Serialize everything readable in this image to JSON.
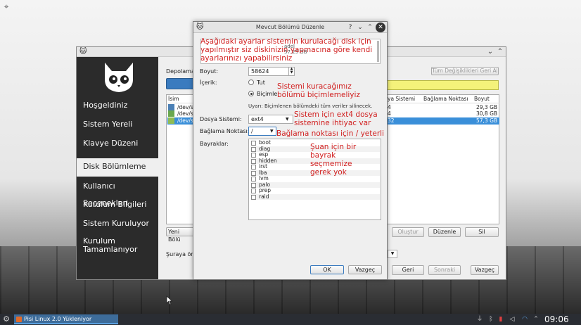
{
  "desktop": {
    "corner_icon": "kde-plasma-icon"
  },
  "installer": {
    "sidebar": [
      {
        "label": "Hoşgeldiniz"
      },
      {
        "label": "Sistem Yereli"
      },
      {
        "label": "Klavye Düzeni"
      },
      {
        "label": "Disk Bölümleme"
      },
      {
        "label": "Kullanıcı Seçenekleri"
      },
      {
        "label": "Kurulum Bilgileri"
      },
      {
        "label": "Sistem Kuruluyor"
      },
      {
        "label": "Kurulum Tamamlanıyor"
      }
    ],
    "storage_label": "Depolama",
    "revert_all_button": "Tüm Değişiklikleri Geri Al",
    "table": {
      "headers": [
        "İsim",
        "ya Sistemi",
        "Bağlama Noktası",
        "Boyut"
      ],
      "rows": [
        {
          "name": "/dev/s",
          "fs": "4",
          "size": "29,3 GB"
        },
        {
          "name": "/dev/s",
          "fs": "4",
          "size": "30,8 GB"
        },
        {
          "name": "/dev/s",
          "fs": "32",
          "size": "57,3 GB"
        }
      ]
    },
    "new_partition_table_button": "Yeni Bölü",
    "create_button": "Oluştur",
    "edit_button": "Düzenle",
    "delete_button": "Sil",
    "bootloader_label": "Şuraya ön",
    "back_button": "Geri",
    "next_button": "Sonraki",
    "cancel_button": "Vazgeç"
  },
  "dialog": {
    "title": "Mevcut Bölümü Düzenle",
    "help_button": "?",
    "info_text_fragment_1": "adel",
    "info_text_fragment_2": "57,25 GB",
    "size_label": "Boyut:",
    "size_value": "58624",
    "content_label": "İçerik:",
    "keep_option": "Tut",
    "format_option": "Biçimle",
    "warning": "Uyarı: Biçimlenen bölümdeki tüm veriler silinecek.",
    "filesystem_label": "Dosya Sistemi:",
    "filesystem_value": "ext4",
    "mountpoint_label": "Bağlama Noktası:",
    "mountpoint_value": "/",
    "flags_label": "Bayraklar:",
    "flags": [
      "boot",
      "diag",
      "esp",
      "hidden",
      "irst",
      "lba",
      "lvm",
      "palo",
      "prep",
      "raid"
    ],
    "ok_button": "OK",
    "cancel_button": "Vazgeç"
  },
  "annotations": {
    "a1": "Aşağıdaki ayarlar sistemin kurulacağı disk için yapılmıştır siz diskinizin yapmacına göre kendi ayarlarınızı yapabilirsiniz",
    "a2": "Sistemi kuracağımız bölümü biçimlemeliyiz",
    "a3": "Sistem için ext4 dosya sistemine ihtiyac var",
    "a4": "Bağlama noktası için / yeterli",
    "a5": "Şuan için bir bayrak seçmemize gerek yok",
    "color": "#d11f1f"
  },
  "taskbar": {
    "app_label": "Pisi Linux 2.0 Yükleniyor",
    "clock": "09:06",
    "tray_icons": [
      "usb-icon",
      "bluetooth-icon",
      "battery-icon",
      "volume-icon",
      "wifi-icon",
      "arrow-up-icon"
    ]
  },
  "colors": {
    "selection": "#3a8fd9",
    "highlight_bar": "#f4f27a",
    "taskbar": "#2a2d33",
    "sidebar": "#2b2b2b"
  }
}
